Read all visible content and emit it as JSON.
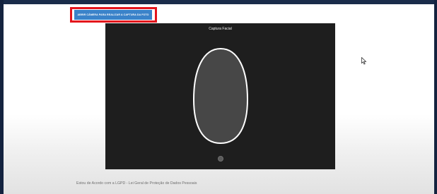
{
  "toolbar": {
    "open_camera_label": "ABRIR CÂMERA PARA REALIZAR A CAPTURA DA FOTO"
  },
  "capture": {
    "title": "Captura Facial"
  },
  "consent": {
    "text": "Estou de Acordo com a LGPD - Lei Geral de Proteção de Dados Pessoais"
  },
  "icons": {
    "face_guide": "face-oval-outline",
    "shutter": "shutter-dot",
    "cursor": "arrow-cursor"
  },
  "colors": {
    "button_bg": "#3a82c9",
    "highlight": "#e3141c",
    "capture_bg": "#1e1e1e",
    "guide_stroke": "#ffffff"
  }
}
